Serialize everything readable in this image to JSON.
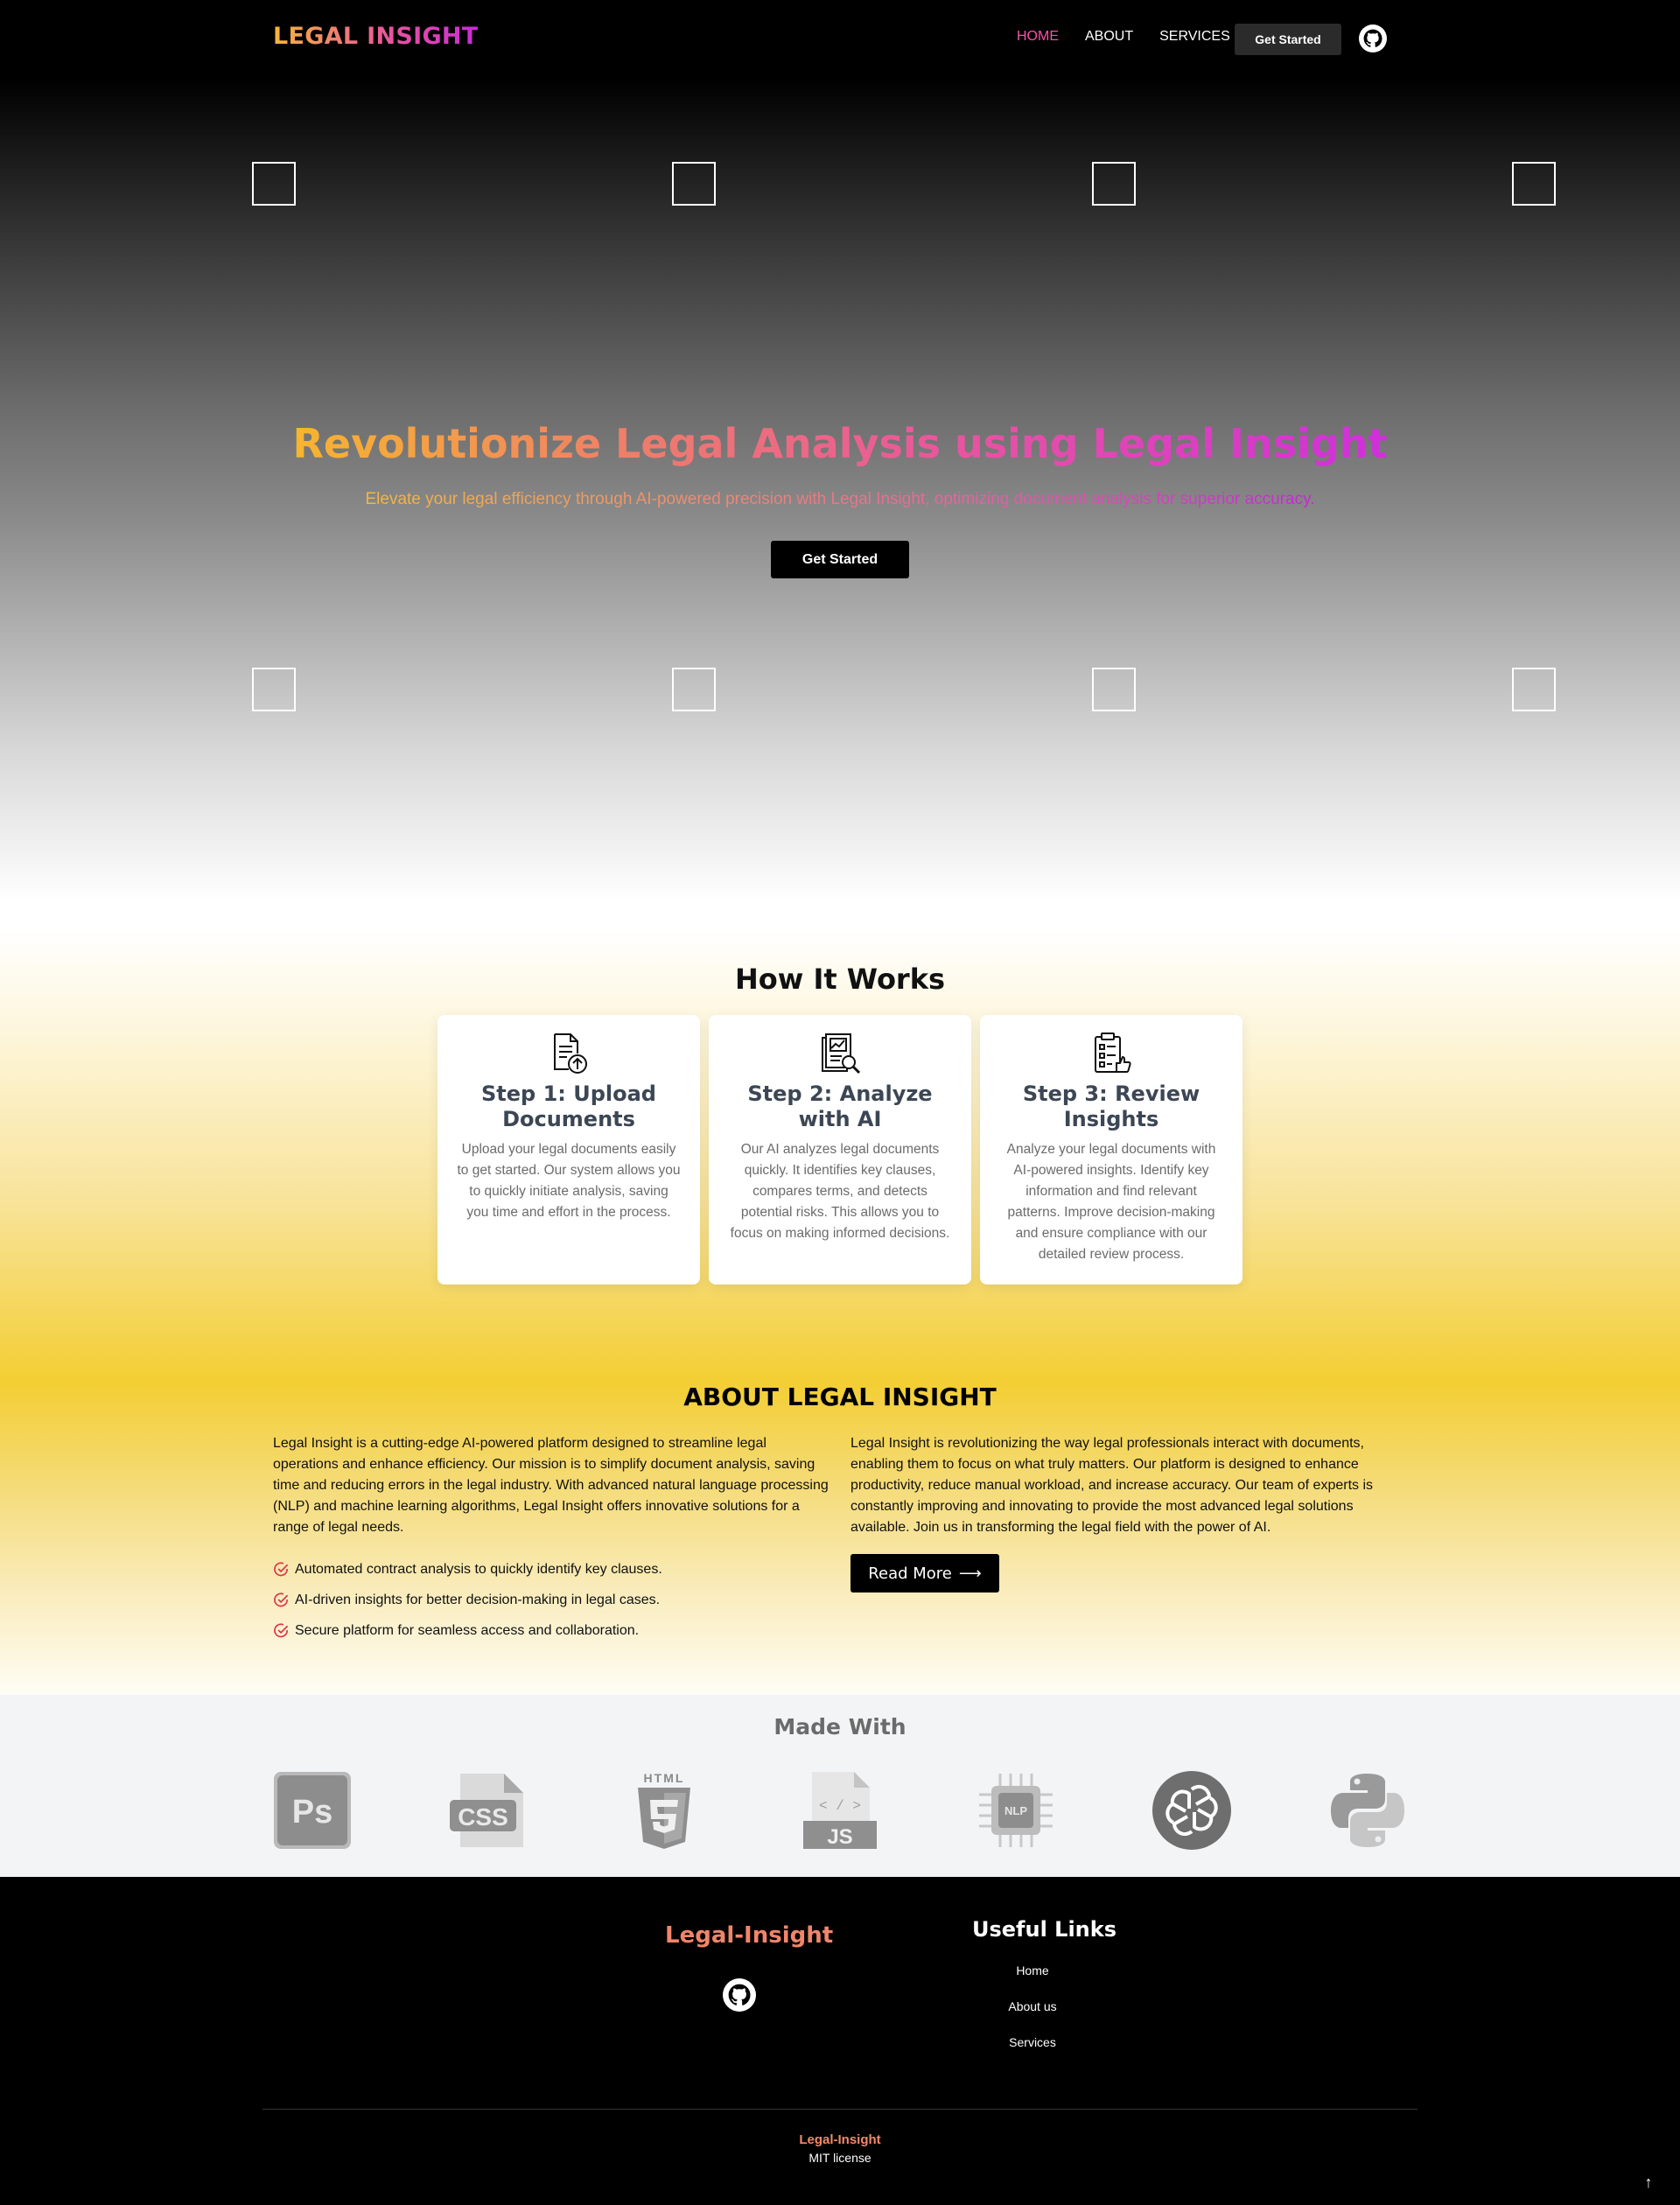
{
  "nav": {
    "logo": "LEGAL INSIGHT",
    "links": [
      {
        "label": "HOME",
        "active": true
      },
      {
        "label": "ABOUT",
        "active": false
      },
      {
        "label": "SERVICES",
        "active": false
      }
    ],
    "cta_label": "Get Started",
    "github_icon": "github-icon"
  },
  "hero": {
    "title": "Revolutionize Legal Analysis using Legal Insight",
    "subtitle": "Elevate your legal efficiency through AI-powered precision with Legal Insight, optimizing document analysis for superior accuracy.",
    "cta_label": "Get Started"
  },
  "how": {
    "title": "How It Works",
    "steps": [
      {
        "icon": "document-upload-icon",
        "title": "Step 1: Upload Documents",
        "text": "Upload your legal documents easily to get started. Our system allows you to quickly initiate analysis, saving you time and effort in the process."
      },
      {
        "icon": "document-analysis-icon",
        "title": "Step 2: Analyze with AI",
        "text": "Our AI analyzes legal documents quickly. It identifies key clauses, compares terms, and detects potential risks. This allows you to focus on making informed decisions."
      },
      {
        "icon": "clipboard-review-icon",
        "title": "Step 3: Review Insights",
        "text": "Analyze your legal documents with AI-powered insights. Identify key information and find relevant patterns. Improve decision-making and ensure compliance with our detailed review process."
      }
    ]
  },
  "about": {
    "title": "ABOUT LEGAL INSIGHT",
    "left_text": "Legal Insight is a cutting-edge AI-powered platform designed to streamline legal operations and enhance efficiency. Our mission is to simplify document analysis, saving time and reducing errors in the legal industry. With advanced natural language processing (NLP) and machine learning algorithms, Legal Insight offers innovative solutions for a range of legal needs.",
    "features": [
      "Automated contract analysis to quickly identify key clauses.",
      "AI-driven insights for better decision-making in legal cases.",
      "Secure platform for seamless access and collaboration."
    ],
    "right_text": "Legal Insight is revolutionizing the way legal professionals interact with documents, enabling them to focus on what truly matters. Our platform is designed to enhance productivity, reduce manual workload, and increase accuracy. Our team of experts is constantly improving and innovating to provide the most advanced legal solutions available. Join us in transforming the legal field with the power of AI.",
    "read_more_label": "Read More",
    "check_icon": "check-circle-icon"
  },
  "made_with": {
    "title": "Made With",
    "icons": [
      "photoshop-icon",
      "css-icon",
      "html5-icon",
      "javascript-icon",
      "nlp-chip-icon",
      "openai-icon",
      "python-icon"
    ],
    "labels": {
      "ps": "Ps",
      "css": "CSS",
      "html": "HTML",
      "js": "JS",
      "nlp": "NLP"
    }
  },
  "footer": {
    "brand": "Legal-Insight",
    "links_title": "Useful Links",
    "links": [
      "Home",
      "About us",
      "Services"
    ],
    "bottom_brand": "Legal-Insight",
    "license": "MIT license",
    "to_top_icon": "arrow-up-icon"
  },
  "colors": {
    "accent_orange": "#f5b63a",
    "accent_pink": "#e9579b",
    "accent_magenta": "#c92bd6",
    "gold": "#f3ce33"
  }
}
